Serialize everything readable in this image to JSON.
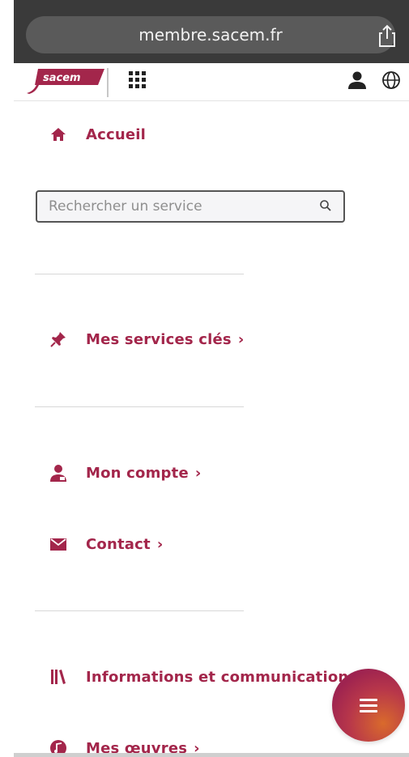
{
  "browser": {
    "url": "membre.sacem.fr"
  },
  "header": {
    "logo_text": "sacem"
  },
  "menu": {
    "home": "Accueil",
    "search_placeholder": "Rechercher un service",
    "key_services": "Mes services clés",
    "account": "Mon compte",
    "contact": "Contact",
    "info": "Informations et communications",
    "works": "Mes œuvres",
    "chevron": "›"
  },
  "colors": {
    "accent": "#a3264b",
    "browser_bar": "#3a3a3a"
  },
  "icons": {
    "home": "home-icon",
    "pin": "pin-icon",
    "user": "user-icon",
    "mail": "mail-icon",
    "library": "library-icon",
    "music": "music-note-icon",
    "apps": "apps-grid-icon",
    "globe": "globe-icon",
    "share": "share-icon",
    "search": "search-icon",
    "menu": "hamburger-icon"
  }
}
